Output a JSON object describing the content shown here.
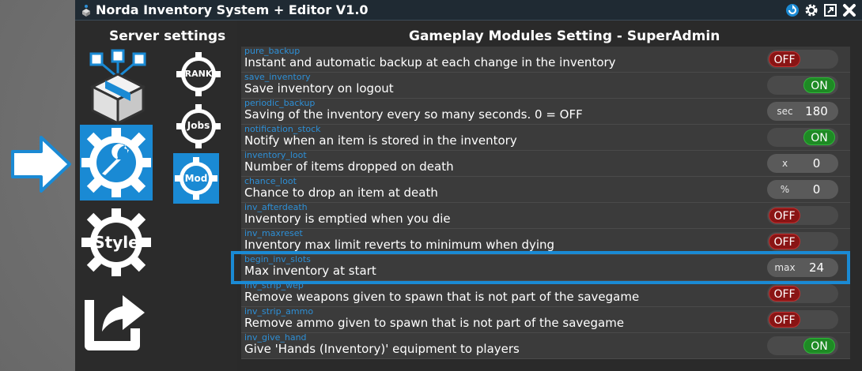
{
  "window": {
    "title": "Norda Inventory System + Editor V1.0"
  },
  "titlebar_icons": [
    "refresh-icon",
    "gear-icon",
    "maximize-icon",
    "close-icon"
  ],
  "sidebar": {
    "heading": "Server settings",
    "items": [
      {
        "name": "inventory-box",
        "label": ""
      },
      {
        "name": "settings-wrench",
        "label": ""
      },
      {
        "name": "style",
        "label": "Style"
      },
      {
        "name": "export",
        "label": ""
      }
    ],
    "modules": [
      {
        "name": "rank",
        "label": "RANK"
      },
      {
        "name": "jobs",
        "label": "Jobs"
      },
      {
        "name": "mod",
        "label": "Mod"
      }
    ]
  },
  "main": {
    "heading": "Gameplay Modules Setting - SuperAdmin",
    "settings": [
      {
        "key": "pure_backup",
        "desc": "Instant and automatic backup at each change in the inventory",
        "type": "toggle",
        "state": "off",
        "label": "OFF"
      },
      {
        "key": "save_inventory",
        "desc": "Save inventory on logout",
        "type": "toggle",
        "state": "on",
        "label": "ON"
      },
      {
        "key": "periodic_backup",
        "desc": "Saving of the inventory every so many seconds. 0 = OFF",
        "type": "number",
        "unit": "sec",
        "value": "180"
      },
      {
        "key": "notification_stock",
        "desc": "Notify when an item is stored in the inventory",
        "type": "toggle",
        "state": "on",
        "label": "ON"
      },
      {
        "key": "inventory_loot",
        "desc": "Number of items dropped on death",
        "type": "number",
        "unit": "x",
        "value": "0"
      },
      {
        "key": "chance_loot",
        "desc": "Chance to drop an item at death",
        "type": "number",
        "unit": "%",
        "value": "0"
      },
      {
        "key": "inv_afterdeath",
        "desc": "Inventory is emptied when you die",
        "type": "toggle",
        "state": "off",
        "label": "OFF"
      },
      {
        "key": "inv_maxreset",
        "desc": "Inventory max limit reverts to minimum when dying",
        "type": "toggle",
        "state": "off",
        "label": "OFF"
      },
      {
        "key": "begin_inv_slots",
        "desc": "Max inventory at start",
        "type": "number",
        "unit": "max",
        "value": "24"
      },
      {
        "key": "inv_strip_wep",
        "desc": "Remove weapons given to spawn that is not part of the savegame",
        "type": "toggle",
        "state": "off",
        "label": "OFF"
      },
      {
        "key": "inv_strip_ammo",
        "desc": "Remove ammo given to spawn that is not part of the savegame",
        "type": "toggle",
        "state": "off",
        "label": "OFF"
      },
      {
        "key": "inv_give_hand",
        "desc": "Give 'Hands (Inventory)' equipment to players",
        "type": "toggle",
        "state": "on",
        "label": "ON"
      }
    ]
  },
  "colors": {
    "accent": "#1a8ad4",
    "on": "#1e8a24",
    "off": "#8a1414"
  }
}
